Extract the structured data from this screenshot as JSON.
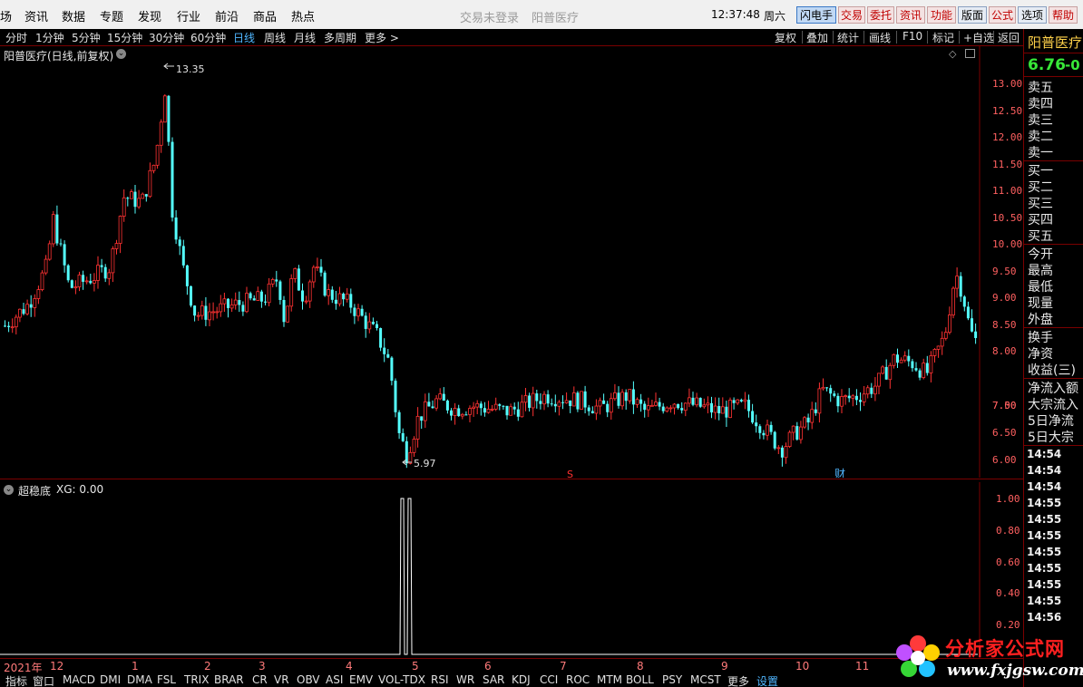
{
  "menu": {
    "items": [
      "场",
      "资讯",
      "数据",
      "专题",
      "发现",
      "行业",
      "前沿",
      "商品",
      "热点"
    ],
    "status_login": "交易未登录",
    "status_stock": "阳普医疗",
    "time": "12:37:48",
    "weekday": "周六",
    "buttons": [
      "闪电手",
      "交易",
      "委托",
      "资讯",
      "功能",
      "版面",
      "公式",
      "选项",
      "帮助"
    ]
  },
  "periods": [
    "分时",
    "1分钟",
    "5分钟",
    "15分钟",
    "30分钟",
    "60分钟",
    "日线",
    "周线",
    "月线",
    "多周期",
    "更多 >"
  ],
  "active_period": "日线",
  "tools": [
    "复权",
    "叠加",
    "统计",
    "画线",
    "F10",
    "标记",
    "+自选",
    "返回"
  ],
  "main_chart": {
    "title": "阳普医疗(日线,前复权)",
    "high_label": "13.35",
    "low_label": "5.97",
    "marker_s": "S",
    "marker_cai": "财",
    "axis_ticks": [
      "13.00",
      "12.50",
      "12.00",
      "11.50",
      "11.00",
      "10.50",
      "10.00",
      "9.50",
      "9.00",
      "8.50",
      "8.00",
      "7.50",
      "7.00",
      "6.50",
      "6.00"
    ]
  },
  "indicator": {
    "title": "超稳底",
    "value_label": "XG: 0.00",
    "axis_ticks": [
      "1.00",
      "0.80",
      "0.60",
      "0.40",
      "0.20"
    ]
  },
  "info_panel": {
    "name": "阳普医疗",
    "price": "6.76",
    "change": "-0",
    "rows": [
      "卖五",
      "卖四",
      "卖三",
      "卖二",
      "卖一",
      "买一",
      "买二",
      "买三",
      "买四",
      "买五",
      "今开",
      "最高",
      "最低",
      "现量",
      "外盘",
      "换手",
      "净资",
      "收益(三)",
      "净流入额",
      "大宗流入",
      "5日净流",
      "5日大宗"
    ],
    "times": [
      "14:54",
      "14:54",
      "14:54",
      "14:55",
      "14:55",
      "14:55",
      "14:55",
      "14:55",
      "14:55",
      "14:55",
      "14:56"
    ]
  },
  "date_axis": [
    "2021年",
    "12",
    "1",
    "2",
    "3",
    "4",
    "5",
    "6",
    "7",
    "8",
    "9",
    "10",
    "11"
  ],
  "indicator_tabs": [
    "指标",
    "窗口",
    "MACD",
    "DMI",
    "DMA",
    "FSL",
    "TRIX",
    "BRAR",
    "CR",
    "VR",
    "OBV",
    "ASI",
    "EMV",
    "VOL-TDX",
    "RSI",
    "WR",
    "SAR",
    "KDJ",
    "CCI",
    "ROC",
    "MTM",
    "BOLL",
    "PSY",
    "MCST",
    "更多",
    "设置"
  ],
  "watermark": {
    "title": "分析家公式网",
    "url": "www.fxjgsw.com"
  },
  "colors": {
    "up": "#ff3232",
    "down": "#54ffff",
    "axis": "#ff6060",
    "frame": "#7a0000",
    "accent": "#4fb6ff"
  }
}
